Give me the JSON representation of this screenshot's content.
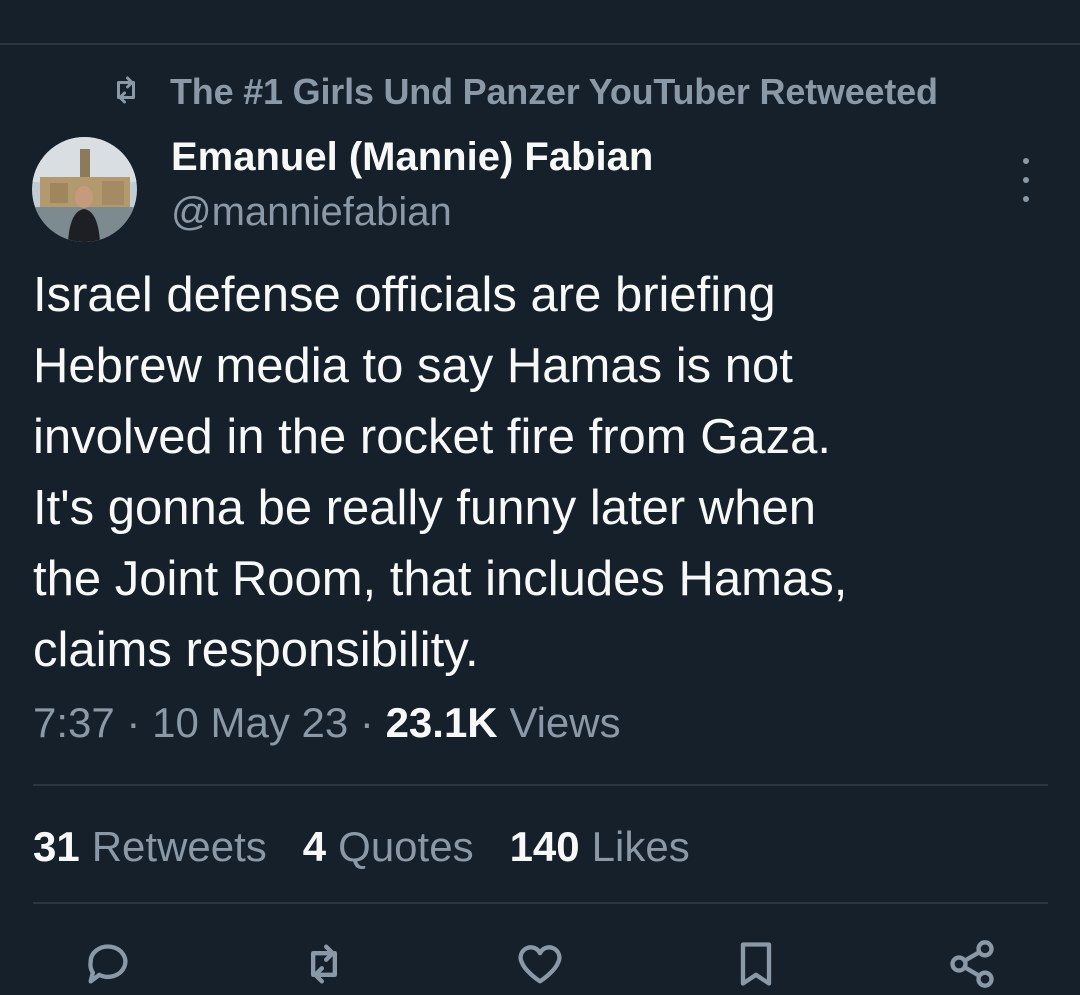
{
  "retweet_context": {
    "text": "The #1 Girls Und Panzer YouTuber Retweeted"
  },
  "author": {
    "display_name": "Emanuel (Mannie) Fabian",
    "handle": "@manniefabian"
  },
  "tweet": {
    "text": "Israel defense officials are briefing\nHebrew media to say Hamas is not\ninvolved in the rocket fire from Gaza.\nIt's gonna be really funny later when\nthe Joint Room, that includes Hamas,\nclaims responsibility.",
    "time": "7:37",
    "separator": "·",
    "date": "10 May 23",
    "views_count": "23.1K",
    "views_label": "Views"
  },
  "stats": {
    "retweets_count": "31",
    "retweets_label": "Retweets",
    "quotes_count": "4",
    "quotes_label": "Quotes",
    "likes_count": "140",
    "likes_label": "Likes"
  },
  "icons": {
    "retweet_context": "retweet-icon",
    "more": "more-vertical-icon",
    "actions": [
      "reply-icon",
      "retweet-icon",
      "heart-icon",
      "bookmark-icon",
      "share-icon"
    ]
  },
  "colors": {
    "background": "#15202b",
    "text_primary": "#f7f9f9",
    "text_secondary": "#8b98a5",
    "divider": "#2a3540"
  }
}
